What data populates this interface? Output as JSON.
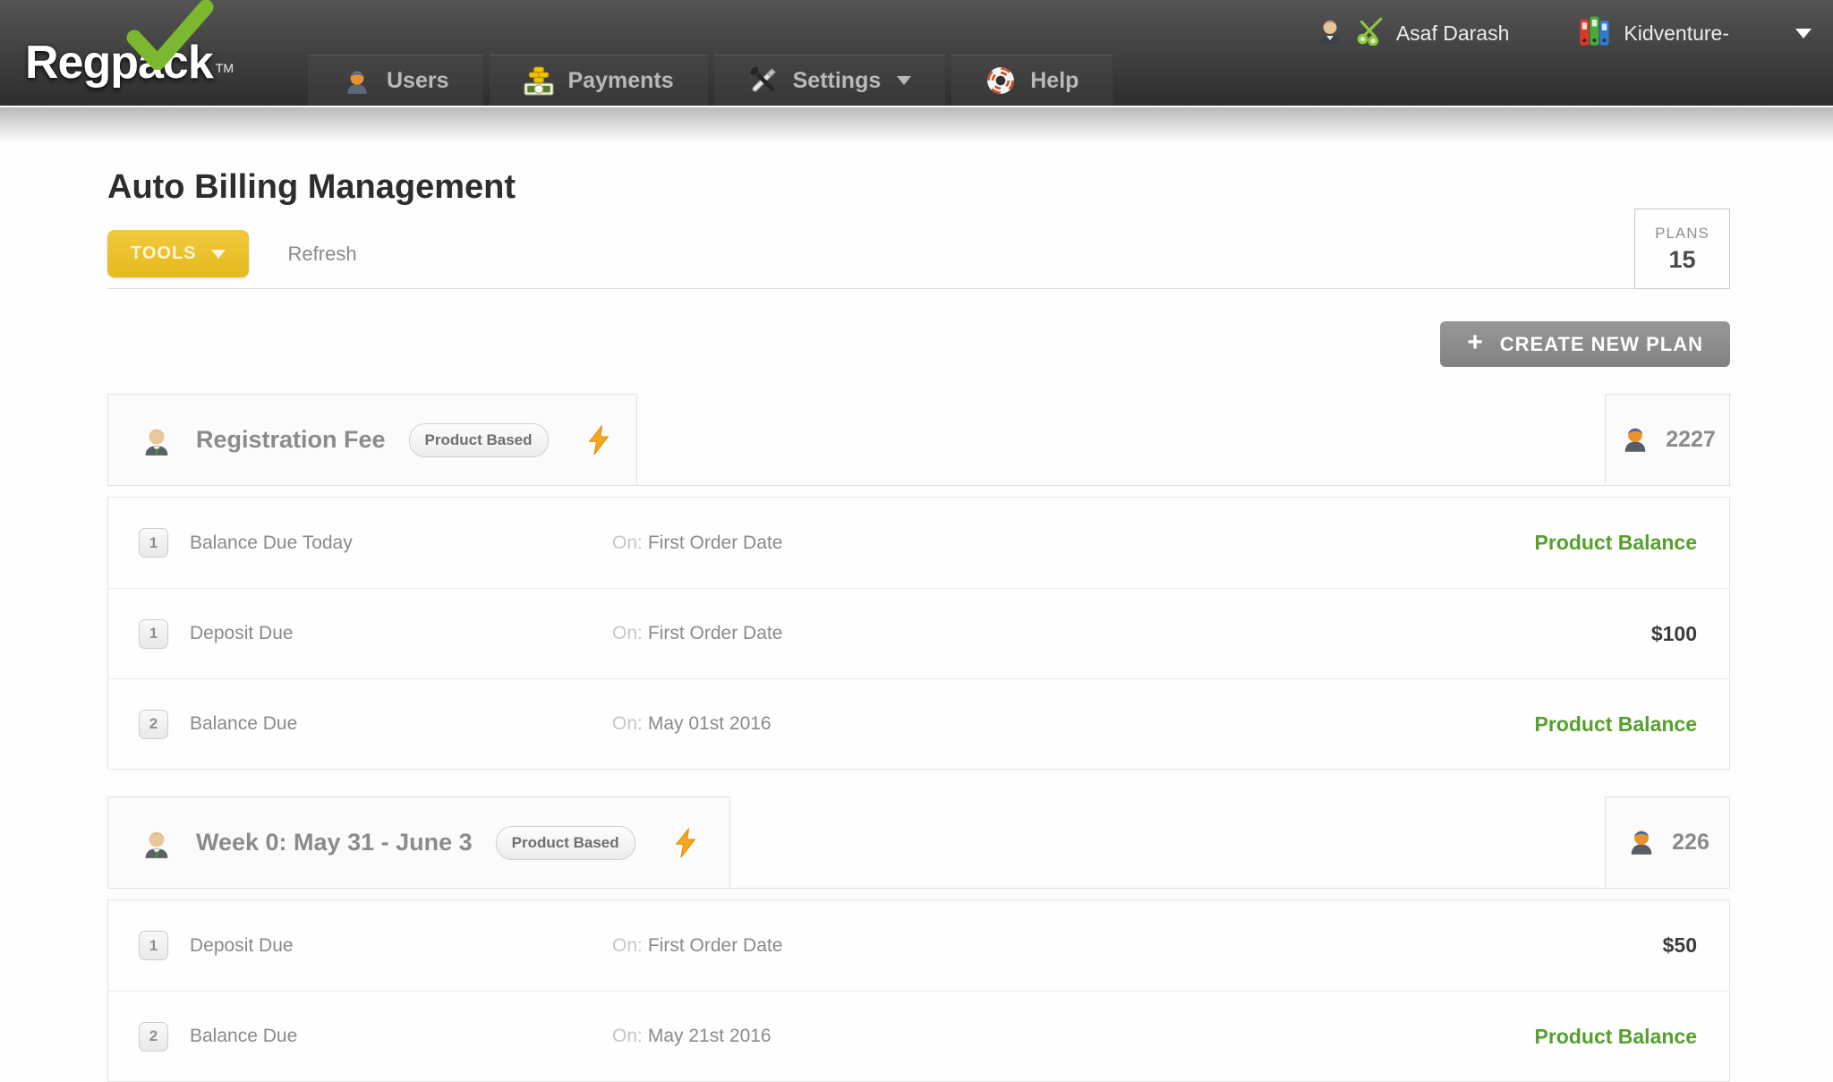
{
  "brand": {
    "name": "Regpack",
    "trademark": "TM"
  },
  "nav": {
    "items": [
      {
        "label": "Users"
      },
      {
        "label": "Payments"
      },
      {
        "label": "Settings"
      },
      {
        "label": "Help"
      }
    ],
    "user_name": "Asaf Darash",
    "account_name": "Kidventure-"
  },
  "page": {
    "title": "Auto Billing Management"
  },
  "toolbar": {
    "tools_label": "TOOLS",
    "refresh_label": "Refresh",
    "plans_label": "PLANS",
    "plans_count": "15",
    "create_label": "CREATE NEW PLAN"
  },
  "plans": [
    {
      "name": "Registration Fee",
      "badge": "Product Based",
      "user_count": "2227",
      "rows": [
        {
          "num": "1",
          "name": "Balance Due Today",
          "on_label": "On:",
          "date": "First Order Date",
          "value": "Product Balance"
        },
        {
          "num": "1",
          "name": "Deposit Due",
          "on_label": "On:",
          "date": "First Order Date",
          "value": "$100"
        },
        {
          "num": "2",
          "name": "Balance Due",
          "on_label": "On:",
          "date": "May 01st 2016",
          "value": "Product Balance"
        }
      ]
    },
    {
      "name": "Week 0: May 31 - June 3",
      "badge": "Product Based",
      "user_count": "226",
      "rows": [
        {
          "num": "1",
          "name": "Deposit Due",
          "on_label": "On:",
          "date": "First Order Date",
          "value": "$50"
        },
        {
          "num": "2",
          "name": "Balance Due",
          "on_label": "On:",
          "date": "May 21st 2016",
          "value": "Product Balance"
        }
      ]
    }
  ],
  "colors": {
    "accent_yellow": "#e8bb20",
    "status_green": "#55a02c",
    "button_gray": "#8c8c8c",
    "logo_green": "#7cb82f"
  }
}
